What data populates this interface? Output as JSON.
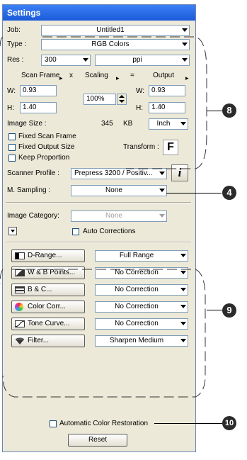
{
  "title": "Settings",
  "job": {
    "label": "Job:",
    "value": "Untitled1"
  },
  "type": {
    "label": "Type :",
    "value": "RGB Colors"
  },
  "res": {
    "label": "Res :",
    "value": "300",
    "unit": "ppi"
  },
  "headers": {
    "scan_frame": "Scan Frame",
    "x": "x",
    "scaling": "Scaling",
    "eq": "=",
    "output": "Output"
  },
  "scan": {
    "w_label": "W:",
    "w": "0.93",
    "h_label": "H:",
    "h": "1.40"
  },
  "scaling": {
    "value": "100%"
  },
  "output": {
    "w_label": "W:",
    "w": "0.93",
    "h_label": "H:",
    "h": "1.40"
  },
  "image_size": {
    "label": "Image Size :",
    "value": "345",
    "unit": "KB",
    "units_select": "Inch"
  },
  "checks": {
    "fixed_scan_frame": "Fixed Scan Frame",
    "fixed_output_size": "Fixed Output Size",
    "keep_proportion": "Keep Proportion"
  },
  "transform": {
    "label": "Transform :",
    "icon_letter": "F"
  },
  "scanner_profile": {
    "label": "Scanner Profile :",
    "value": "Prepress 3200 / Positiv...",
    "info_glyph": "i"
  },
  "m_sampling": {
    "label": "M. Sampling :",
    "value": "None"
  },
  "image_category": {
    "label": "Image Category:",
    "value": "None"
  },
  "auto_corrections": {
    "label": "Auto Corrections"
  },
  "corrections": [
    {
      "button": "D-Range...",
      "value": "Full Range",
      "icon": "d-range-icon"
    },
    {
      "button": "W & B Points...",
      "value": "No Correction",
      "icon": "wb-points-icon"
    },
    {
      "button": "B & C...",
      "value": "No Correction",
      "icon": "bc-icon"
    },
    {
      "button": "Color Corr...",
      "value": "No Correction",
      "icon": "color-corr-icon"
    },
    {
      "button": "Tone Curve...",
      "value": "No Correction",
      "icon": "tone-curve-icon"
    },
    {
      "button": "Filter...",
      "value": "Sharpen Medium",
      "icon": "filter-icon"
    }
  ],
  "auto_color_restoration": {
    "label": "Automatic Color Restoration"
  },
  "reset": {
    "label": "Reset"
  },
  "callouts": [
    "8",
    "4",
    "9",
    "10"
  ]
}
